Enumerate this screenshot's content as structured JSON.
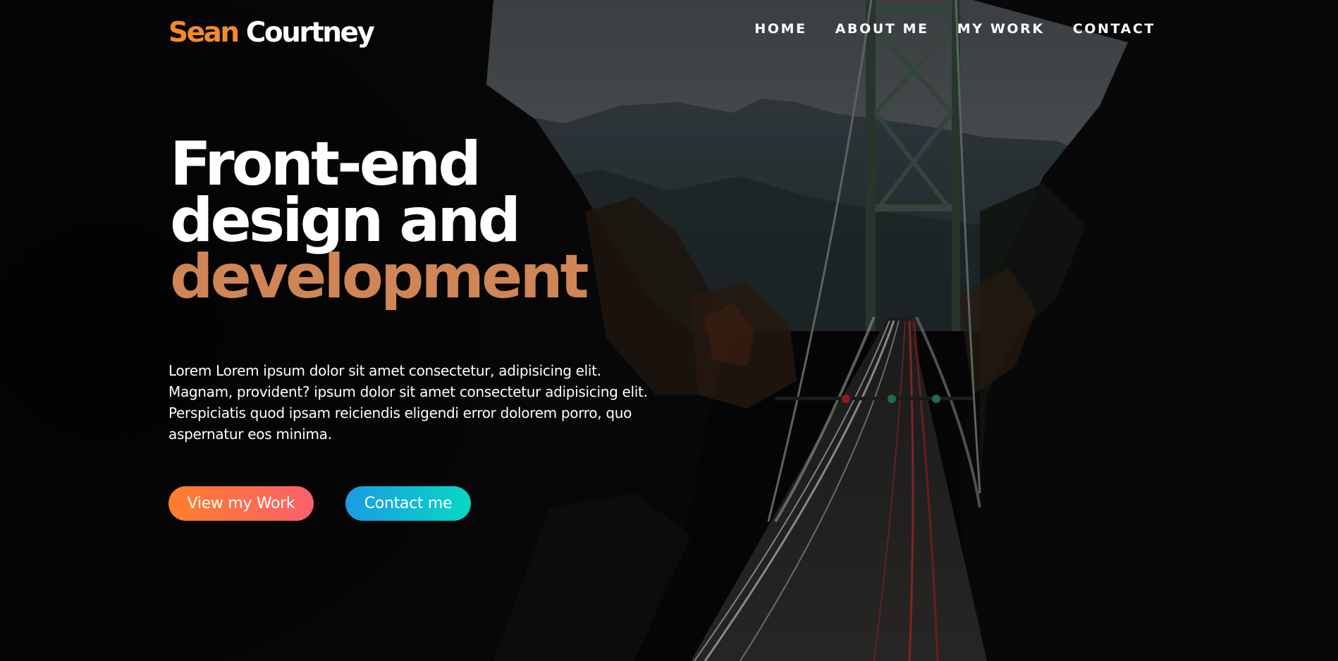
{
  "header": {
    "logo_first": "Sean",
    "logo_last": " Courtney",
    "nav": [
      {
        "label": "HOME"
      },
      {
        "label": "ABOUT ME"
      },
      {
        "label": "MY WORK"
      },
      {
        "label": "CONTACT"
      }
    ]
  },
  "hero": {
    "headline_line1": "Front-end",
    "headline_line2": "design and",
    "headline_line3": "development",
    "intro": "Lorem Lorem ipsum dolor sit amet consectetur, adipisicing elit. Magnam, provident? ipsum dolor sit amet consectetur adipisicing elit. Perspiciatis quod ipsam reiciendis eligendi error dolorem porro, quo aspernatur eos minima.",
    "primary_button": "View my Work",
    "secondary_button": "Contact me"
  },
  "colors": {
    "logo_accent": "#f58a2a",
    "headline_accent": "#cf8556",
    "primary_gradient": [
      "#ff7e2c",
      "#f9606b"
    ],
    "secondary_gradient": [
      "#1c9be2",
      "#06d8c4"
    ]
  }
}
